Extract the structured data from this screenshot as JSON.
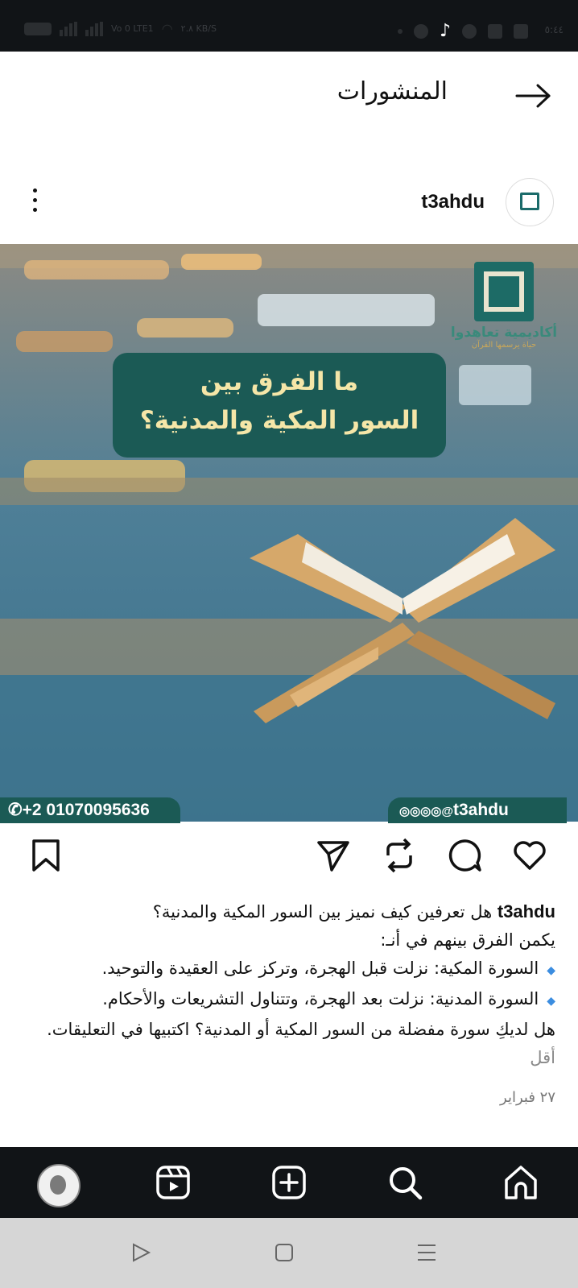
{
  "status_bar": {
    "time": "٥:٤٤",
    "left_text": "Vo 0 LTE1",
    "speed": "٢.٨ KB/S"
  },
  "header": {
    "title": "المنشورات"
  },
  "post": {
    "username": "t3ahdu",
    "image": {
      "title_line1": "ما الفرق بين",
      "title_line2": "السور المكية والمدنية؟",
      "brand_name": "أكاديمية تعاهدوا",
      "brand_tagline": "حياة يرسمها القرآن",
      "phone": "+2 01070095636",
      "social_handle": "t3ahdu"
    },
    "caption": {
      "username": "t3ahdu",
      "line1": "هل تعرفين كيف نميز بين السور المكية والمدنية؟",
      "line2": "يكمن الفرق بينهم في أنـ:",
      "bullet1": "السورة المكية: نزلت قبل الهجرة، وتركز على العقيدة والتوحيد.",
      "bullet2": "السورة المدنية: نزلت بعد الهجرة، وتتناول التشريعات والأحكام.",
      "line3": "هل لديكِ سورة مفضلة من السور المكية أو المدنية؟ اكتبيها في التعليقات.",
      "less": "أقل"
    },
    "date": "٢٧ فبراير"
  }
}
